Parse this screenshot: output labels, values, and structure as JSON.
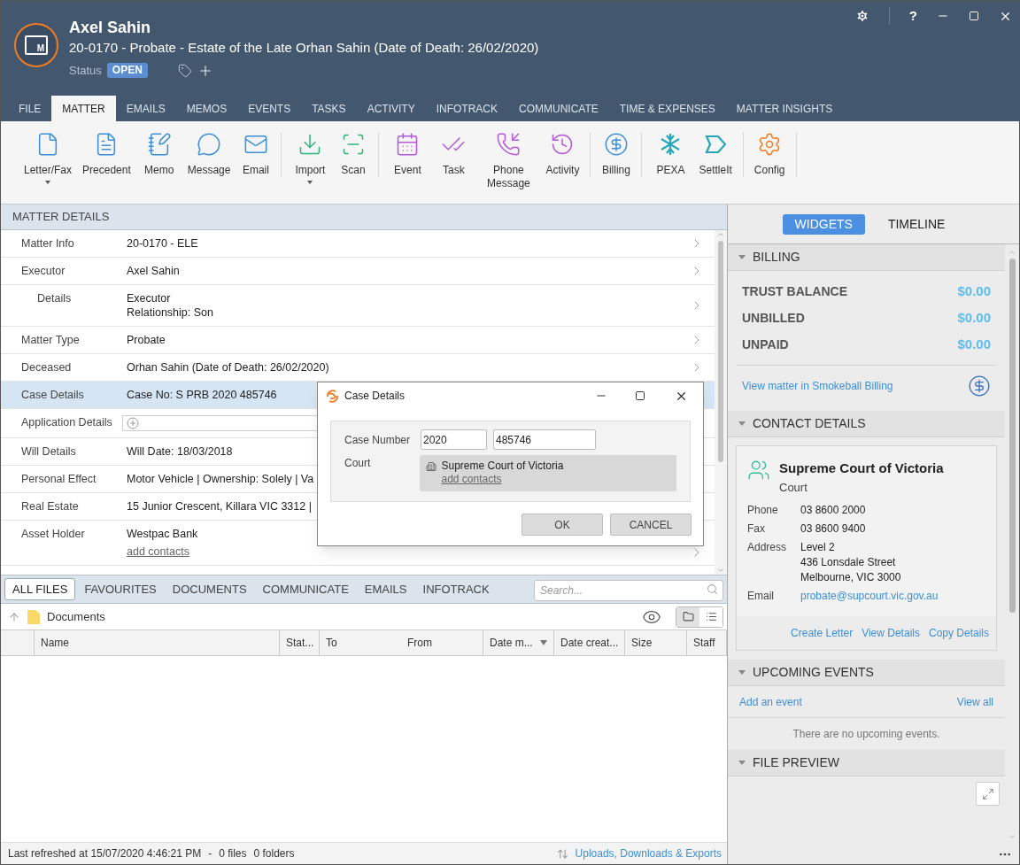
{
  "header": {
    "logo_letter": "M",
    "name": "Axel Sahin",
    "matter": "20-0170 - Probate - Estate of the Late Orhan Sahin (Date of Death: 26/02/2020)",
    "status_label": "Status",
    "status": "OPEN",
    "help": "?"
  },
  "tabs": [
    {
      "label": "FILE",
      "selected": false
    },
    {
      "label": "MATTER",
      "selected": true
    },
    {
      "label": "EMAILS",
      "selected": false
    },
    {
      "label": "MEMOS",
      "selected": false
    },
    {
      "label": "EVENTS",
      "selected": false
    },
    {
      "label": "TASKS",
      "selected": false
    },
    {
      "label": "ACTIVITY",
      "selected": false
    },
    {
      "label": "INFOTRACK",
      "selected": false
    },
    {
      "label": "COMMUNICATE",
      "selected": false
    },
    {
      "label": "TIME & EXPENSES",
      "selected": false
    },
    {
      "label": "MATTER INSIGHTS",
      "selected": false
    }
  ],
  "ribbon": [
    {
      "label": "Letter/Fax",
      "kind": "letter",
      "color": "#3d8fd6",
      "dropdown": true,
      "separator_after": false
    },
    {
      "label": "Precedent",
      "kind": "precedent",
      "color": "#3d8fd6",
      "dropdown": false,
      "separator_after": false
    },
    {
      "label": "Memo",
      "kind": "memo",
      "color": "#3d8fd6",
      "dropdown": false,
      "separator_after": false
    },
    {
      "label": "Message",
      "kind": "message",
      "color": "#3d8fd6",
      "dropdown": false,
      "separator_after": false
    },
    {
      "label": "Email",
      "kind": "email",
      "color": "#3d8fd6",
      "dropdown": false,
      "separator_after": true
    },
    {
      "label": "Import",
      "kind": "import",
      "color": "#2fb57a",
      "dropdown": true,
      "separator_after": false
    },
    {
      "label": "Scan",
      "kind": "scan",
      "color": "#2fb57a",
      "dropdown": false,
      "separator_after": true
    },
    {
      "label": "Event",
      "kind": "event",
      "color": "#b45ad8",
      "dropdown": false,
      "separator_after": false
    },
    {
      "label": "Task",
      "kind": "task",
      "color": "#b45ad8",
      "dropdown": false,
      "separator_after": false
    },
    {
      "label": "Phone Message",
      "kind": "phone",
      "color": "#b45ad8",
      "dropdown": false,
      "separator_after": false
    },
    {
      "label": "Activity",
      "kind": "activity",
      "color": "#b45ad8",
      "dropdown": false,
      "separator_after": true
    },
    {
      "label": "Billing",
      "kind": "billing",
      "color": "#3d8fd6",
      "dropdown": false,
      "separator_after": true
    },
    {
      "label": "PEXA",
      "kind": "pexa",
      "color": "#26a7b8",
      "dropdown": false,
      "separator_after": false
    },
    {
      "label": "SettleIt",
      "kind": "settleit",
      "color": "#26a7b8",
      "dropdown": false,
      "separator_after": true
    },
    {
      "label": "Config",
      "kind": "config",
      "color": "#f07c22",
      "dropdown": false,
      "separator_after": true
    }
  ],
  "matter_details": {
    "title": "MATTER DETAILS",
    "rows": [
      {
        "label": "Matter Info",
        "lines": [
          "20-0170 - ELE"
        ],
        "selected": false,
        "chevron": true
      },
      {
        "label": "Executor",
        "lines": [
          "Axel Sahin"
        ],
        "selected": false,
        "chevron": true,
        "children": [
          {
            "label": "Details",
            "lines": [
              "Executor",
              "Relationship: Son"
            ],
            "selected": false,
            "chevron": true
          }
        ]
      },
      {
        "label": "Matter Type",
        "lines": [
          "Probate"
        ],
        "selected": false,
        "chevron": true
      },
      {
        "label": "Deceased",
        "lines": [
          "Orhan Sahin (Date of Death: 26/02/2020)"
        ],
        "selected": false,
        "chevron": true
      },
      {
        "label": "Case Details",
        "lines": [
          "Case No: S PRB 2020 485746"
        ],
        "selected": true,
        "chevron": false
      },
      {
        "label": "Application Details",
        "kind": "field",
        "selected": false,
        "chevron": false
      },
      {
        "label": "Will Details",
        "lines": [
          "Will Date: 18/03/2018"
        ],
        "selected": false,
        "chevron": false
      },
      {
        "label": "Personal Effect",
        "lines": [
          "Motor Vehicle | Ownership: Solely | Va"
        ],
        "selected": false,
        "chevron": false
      },
      {
        "label": "Real Estate",
        "lines": [
          "15 Junior Crescent, Killara VIC 3312 |"
        ],
        "selected": false,
        "chevron": false
      },
      {
        "label": "Asset Holder",
        "lines": [
          "Westpac Bank"
        ],
        "link": "add contacts",
        "selected": false,
        "chevron": true
      }
    ]
  },
  "files": {
    "tabs": [
      {
        "label": "ALL FILES",
        "selected": true
      },
      {
        "label": "FAVOURITES",
        "selected": false
      },
      {
        "label": "DOCUMENTS",
        "selected": false
      },
      {
        "label": "COMMUNICATE",
        "selected": false
      },
      {
        "label": "EMAILS",
        "selected": false
      },
      {
        "label": "INFOTRACK",
        "selected": false
      }
    ],
    "search": {
      "placeholder": "Search..."
    },
    "breadcrumb": "Documents",
    "views": [
      {
        "kind": "folder",
        "selected": true
      },
      {
        "kind": "list",
        "selected": false
      }
    ],
    "columns": [
      {
        "label": "Name",
        "sorted": false
      },
      {
        "label": "Stat...",
        "sorted": false
      },
      {
        "label": "To",
        "sorted": false
      },
      {
        "label": "From",
        "sorted": false
      },
      {
        "label": "Date m...",
        "sorted": true
      },
      {
        "label": "Date creat...",
        "sorted": false
      },
      {
        "label": "Size",
        "sorted": false
      },
      {
        "label": "Staff",
        "sorted": false
      }
    ]
  },
  "status_bar": {
    "refreshed": "Last refreshed at 15/07/2020 4:46:21 PM",
    "dash": "-",
    "files": "0 files",
    "folders": "0 folders",
    "link": "Uploads, Downloads & Exports"
  },
  "side_tabs": [
    {
      "label": "WIDGETS",
      "selected": true
    },
    {
      "label": "TIMELINE",
      "selected": false
    }
  ],
  "billing": {
    "title": "BILLING",
    "expanded": true,
    "rows": [
      {
        "label": "TRUST BALANCE",
        "value": "$0.00"
      },
      {
        "label": "UNBILLED",
        "value": "$0.00"
      },
      {
        "label": "UNPAID",
        "value": "$0.00"
      }
    ],
    "link": "View matter in Smokeball Billing"
  },
  "contact": {
    "title": "CONTACT DETAILS",
    "expanded": true,
    "name": "Supreme Court of Victoria",
    "type": "Court",
    "fields": [
      {
        "label": "Phone",
        "lines": [
          "03 8600 2000"
        ],
        "kind": "text"
      },
      {
        "label": "Fax",
        "lines": [
          "03 8600 9400"
        ],
        "kind": "text"
      },
      {
        "label": "Address",
        "lines": [
          "Level 2",
          "436 Lonsdale Street",
          "Melbourne, VIC 3000"
        ],
        "kind": "text"
      },
      {
        "label": "Email",
        "lines": [
          "probate@supcourt.vic.gov.au"
        ],
        "kind": "link"
      }
    ],
    "actions": [
      "Create Letter",
      "View Details",
      "Copy Details"
    ]
  },
  "events": {
    "title": "UPCOMING EVENTS",
    "expanded": true,
    "add": "Add an event",
    "view_all": "View all",
    "empty": "There are no upcoming events."
  },
  "preview": {
    "title": "FILE PREVIEW",
    "expanded": true
  },
  "dialog": {
    "title": "Case Details",
    "case_label": "Case Number",
    "case_values": [
      "2020",
      "485746"
    ],
    "court_label": "Court",
    "court": "Supreme Court of Victoria",
    "court_link": "add contacts",
    "buttons": [
      "OK",
      "CANCEL"
    ]
  }
}
